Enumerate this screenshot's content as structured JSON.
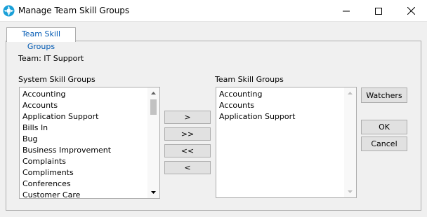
{
  "window": {
    "title": "Manage Team Skill Groups",
    "icon": "app-logo-icon",
    "controls": [
      "minimize-icon",
      "maximize-icon",
      "close-icon"
    ]
  },
  "tab": {
    "label": "Team Skill Groups"
  },
  "team_label": "Team: IT Support",
  "system_list": {
    "header": "System Skill Groups",
    "items": [
      "Accounting",
      "Accounts",
      "Application Support",
      "Bills In",
      "Bug",
      "Business Improvement",
      "Complaints",
      "Compliments",
      "Conferences",
      "Customer Care"
    ]
  },
  "team_list": {
    "header": "Team Skill Groups",
    "items": [
      "Accounting",
      "Accounts",
      "Application Support"
    ]
  },
  "transfer_buttons": {
    "add": ">",
    "add_all": ">>",
    "remove_all": "<<",
    "remove": "<"
  },
  "buttons": {
    "watchers": "Watchers",
    "ok": "OK",
    "cancel": "Cancel"
  },
  "colors": {
    "tab_text": "#0059b3",
    "logo_blue": "#1aa0d8"
  }
}
